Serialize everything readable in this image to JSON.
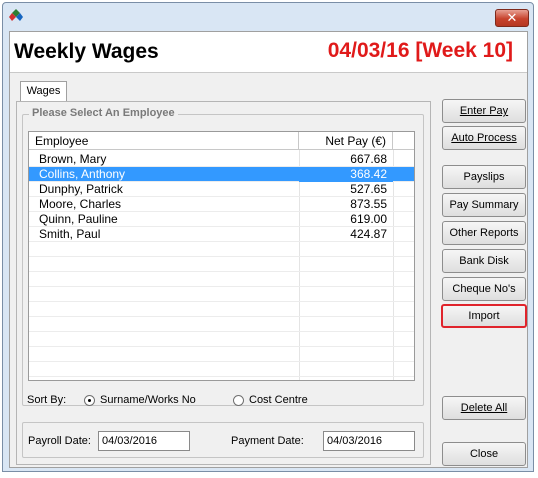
{
  "window": {
    "title_icon": "app-logo-icon",
    "close_glyph": "✕"
  },
  "header": {
    "title": "Weekly Wages",
    "period": "04/03/16 [Week 10]",
    "period_color": "#e01a1a"
  },
  "tabs": [
    {
      "label": "Wages"
    }
  ],
  "employees_group": {
    "legend": "Please Select An Employee",
    "columns": {
      "employee": "Employee",
      "net_pay": "Net Pay (€)"
    },
    "rows": [
      {
        "name": "Brown, Mary",
        "net_pay": "667.68",
        "selected": false
      },
      {
        "name": "Collins, Anthony",
        "net_pay": "368.42",
        "selected": true
      },
      {
        "name": "Dunphy, Patrick",
        "net_pay": "527.65",
        "selected": false
      },
      {
        "name": "Moore, Charles",
        "net_pay": "873.55",
        "selected": false
      },
      {
        "name": "Quinn, Pauline",
        "net_pay": "619.00",
        "selected": false
      },
      {
        "name": "Smith, Paul",
        "net_pay": "424.87",
        "selected": false
      }
    ],
    "selection_color": "#3399ff"
  },
  "sort": {
    "label": "Sort By:",
    "options": [
      {
        "label": "Surname/Works No",
        "selected": true
      },
      {
        "label": "Cost Centre",
        "selected": false
      }
    ]
  },
  "dates": {
    "payroll_label": "Payroll Date:",
    "payroll_value": "04/03/2016",
    "payment_label": "Payment Date:",
    "payment_value": "04/03/2016"
  },
  "actions": {
    "enter_pay": "Enter Pay",
    "auto_process": "Auto Process",
    "payslips": "Payslips",
    "pay_summary": "Pay Summary",
    "other_reports": "Other Reports",
    "bank_disk": "Bank Disk",
    "cheque_nos": "Cheque No's",
    "import": "Import",
    "delete_all": "Delete All",
    "close": "Close",
    "highlight_color": "#e0242c"
  }
}
